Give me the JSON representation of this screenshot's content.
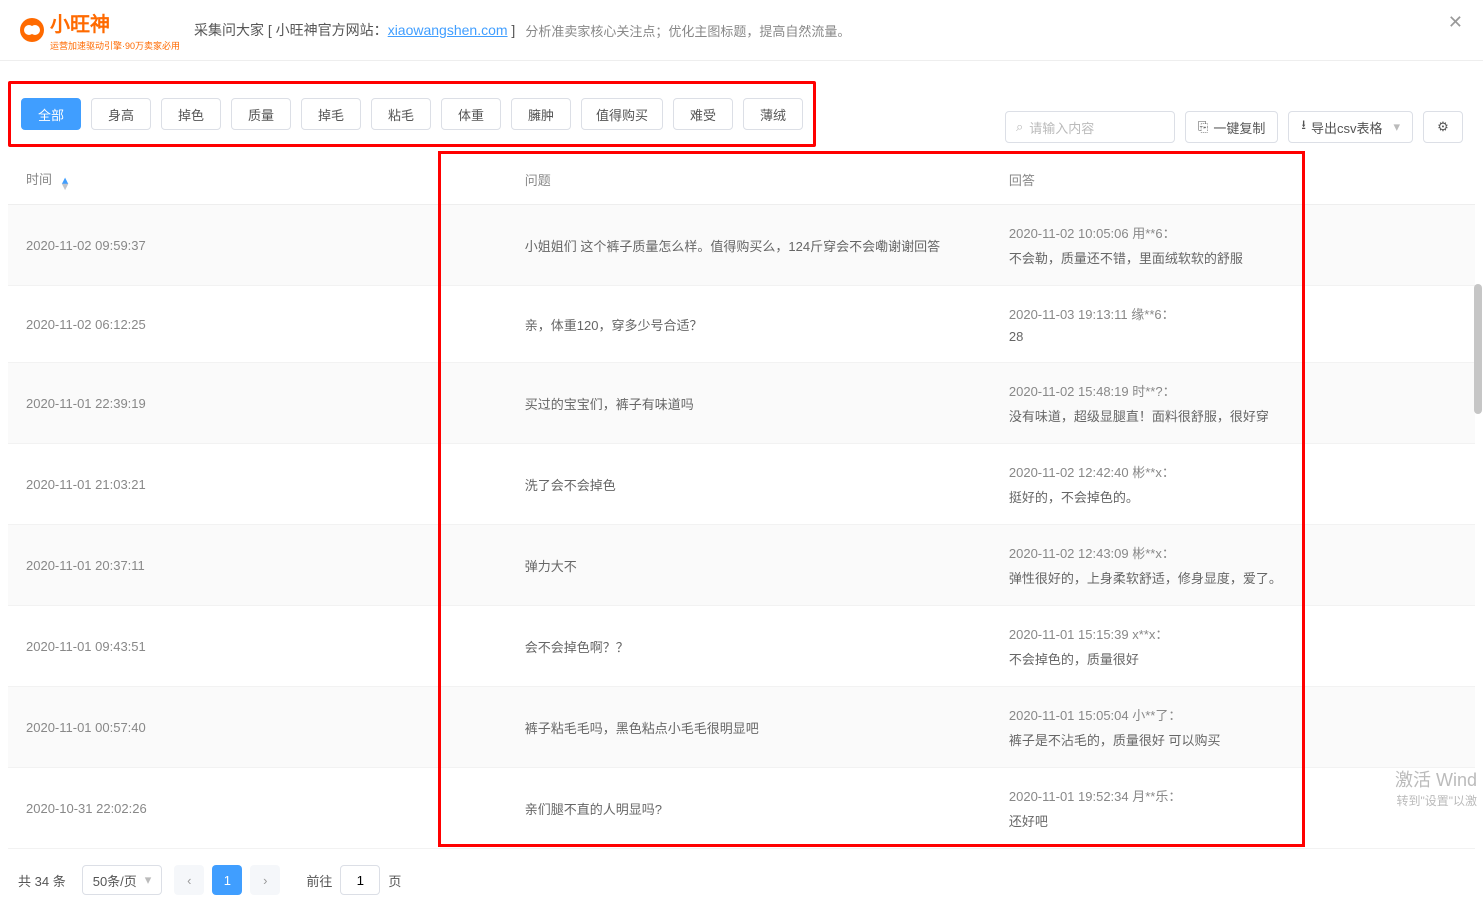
{
  "header": {
    "logo_text": "小旺神",
    "logo_sub": "运营加速驱动引擎·90万卖家必用",
    "title_prefix": "采集问大家 [ 小旺神官方网站：",
    "title_link": "xiaowangshen.com",
    "title_suffix": " ]",
    "desc": "分析准卖家核心关注点；优化主图标题，提高自然流量。",
    "close": "✕"
  },
  "tags": [
    {
      "label": "全部",
      "active": true
    },
    {
      "label": "身高",
      "active": false
    },
    {
      "label": "掉色",
      "active": false
    },
    {
      "label": "质量",
      "active": false
    },
    {
      "label": "掉毛",
      "active": false
    },
    {
      "label": "粘毛",
      "active": false
    },
    {
      "label": "体重",
      "active": false
    },
    {
      "label": "臃肿",
      "active": false
    },
    {
      "label": "值得购买",
      "active": false
    },
    {
      "label": "难受",
      "active": false
    },
    {
      "label": "薄绒",
      "active": false
    }
  ],
  "toolbar": {
    "search_placeholder": "请输入内容",
    "copy_btn": "一键复制",
    "export_btn": "导出csv表格",
    "gear_icon": "⚙"
  },
  "columns": {
    "time": "时间",
    "question": "问题",
    "answer": "回答"
  },
  "rows": [
    {
      "time": "2020-11-02 09:59:37",
      "question": "小姐姐们 这个裤子质量怎么样。值得购买么，124斤穿会不会嘞谢谢回答",
      "answer_meta": "2020-11-02 10:05:06  用**6：",
      "answer_text": "不会勒，质量还不错，里面绒软软的舒服"
    },
    {
      "time": "2020-11-02 06:12:25",
      "question": "亲，体重120，穿多少号合适？",
      "answer_meta": "2020-11-03 19:13:11  缘**6：",
      "answer_text": "28"
    },
    {
      "time": "2020-11-01 22:39:19",
      "question": "买过的宝宝们，裤子有味道吗",
      "answer_meta": "2020-11-02 15:48:19  时**?：",
      "answer_text": "没有味道，超级显腿直！面料很舒服，很好穿"
    },
    {
      "time": "2020-11-01 21:03:21",
      "question": "洗了会不会掉色",
      "answer_meta": "2020-11-02 12:42:40  彬**x：",
      "answer_text": "挺好的，不会掉色的。"
    },
    {
      "time": "2020-11-01 20:37:11",
      "question": "弹力大不",
      "answer_meta": "2020-11-02 12:43:09  彬**x：",
      "answer_text": "弹性很好的，上身柔软舒适，修身显度，爱了。"
    },
    {
      "time": "2020-11-01 09:43:51",
      "question": "会不会掉色啊？？",
      "answer_meta": "2020-11-01 15:15:39  x**x：",
      "answer_text": "不会掉色的，质量很好"
    },
    {
      "time": "2020-11-01 00:57:40",
      "question": "裤子粘毛毛吗，黑色粘点小毛毛很明显吧",
      "answer_meta": "2020-11-01 15:05:04  小**了：",
      "answer_text": "裤子是不沾毛的，质量很好 可以购买"
    },
    {
      "time": "2020-10-31 22:02:26",
      "question": "亲们腿不直的人明显吗?",
      "answer_meta": "2020-11-01 19:52:34  月**乐：",
      "answer_text": "还好吧"
    }
  ],
  "pagination": {
    "total_prefix": "共 ",
    "total_count": "34",
    "total_suffix": " 条",
    "page_size": "50条/页",
    "prev": "‹",
    "current": "1",
    "next": "›",
    "goto_prefix": "前往",
    "goto_value": "1",
    "goto_suffix": "页"
  },
  "watermark": {
    "line1": "激活 Wind",
    "line2": "转到\"设置\"以激"
  }
}
